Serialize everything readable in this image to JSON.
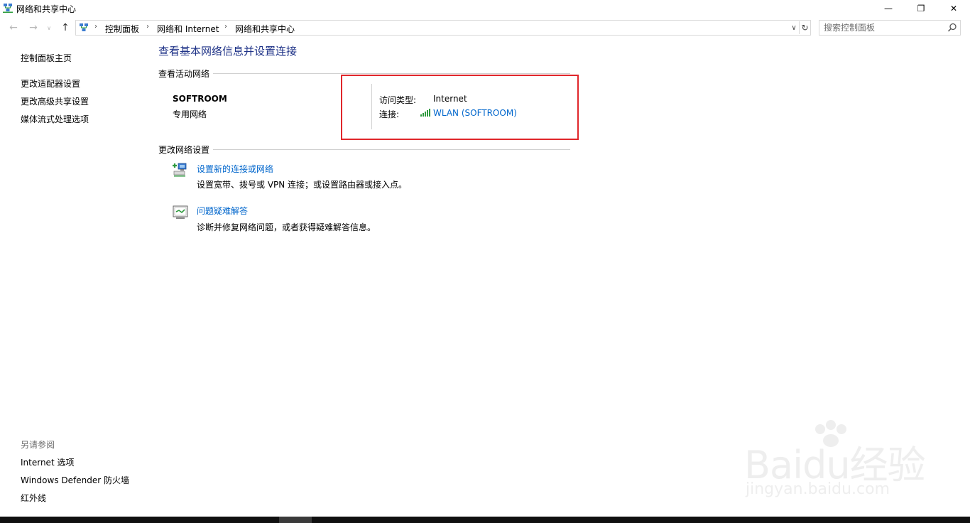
{
  "window": {
    "title": "网络和共享中心",
    "controls": {
      "minimize": "—",
      "maximize": "❐",
      "close": "✕"
    }
  },
  "navigation": {
    "back": "←",
    "forward": "→",
    "recent": "∨",
    "up": "↑",
    "breadcrumbs": [
      "控制面板",
      "网络和 Internet",
      "网络和共享中心"
    ],
    "separator": "›",
    "dropdown": "∨",
    "refresh": "↻",
    "search_placeholder": "搜索控制面板"
  },
  "left_pane": {
    "home": "控制面板主页",
    "links": [
      "更改适配器设置",
      "更改高级共享设置",
      "媒体流式处理选项"
    ],
    "see_also_title": "另请参阅",
    "see_also": [
      "Internet 选项",
      "Windows Defender 防火墙",
      "红外线"
    ]
  },
  "main": {
    "title": "查看基本网络信息并设置连接",
    "active_networks": {
      "heading": "查看活动网络",
      "network_name": "SOFTROOM",
      "network_type": "专用网络",
      "access_type_label": "访问类型:",
      "access_type_value": "Internet",
      "connection_label": "连接:",
      "connection_value": "WLAN (SOFTROOM)"
    },
    "change_settings": {
      "heading": "更改网络设置",
      "tasks": [
        {
          "title": "设置新的连接或网络",
          "description": "设置宽带、拨号或 VPN 连接；或设置路由器或接入点。",
          "icon": "new-connection-icon"
        },
        {
          "title": "问题疑难解答",
          "description": "诊断并修复网络问题，或者获得疑难解答信息。",
          "icon": "troubleshoot-icon"
        }
      ]
    }
  },
  "watermark": {
    "main": "Baidu经验",
    "sub": "jingyan.baidu.com"
  },
  "colors": {
    "title_blue": "#1e3287",
    "link_blue": "#0066cc",
    "highlight_red": "#e0262b",
    "taskbar": "#101010"
  }
}
